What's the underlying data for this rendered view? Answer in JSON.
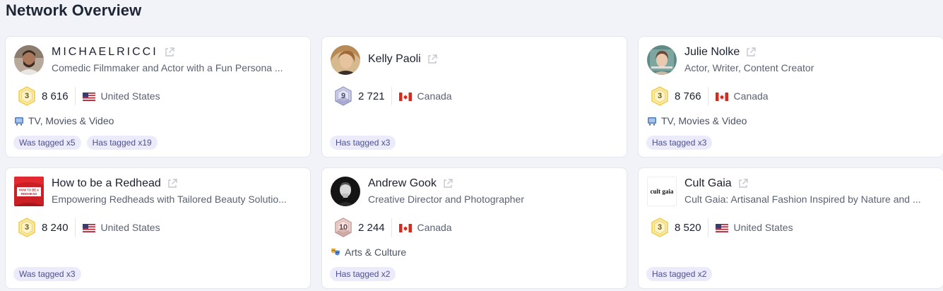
{
  "page_title": "Network Overview",
  "cards": [
    {
      "name": "MICHAELRICCI",
      "bio": "Comedic Filmmaker and Actor with a Fun Persona ...",
      "level": "3",
      "score": "8 616",
      "country": "United States",
      "category": "TV, Movies & Video",
      "tags": [
        "Was tagged x5",
        "Has tagged x19"
      ]
    },
    {
      "name": "Kelly Paoli",
      "bio": "",
      "level": "9",
      "score": "2 721",
      "country": "Canada",
      "category": "",
      "tags": [
        "Has tagged x3"
      ]
    },
    {
      "name": "Julie Nolke",
      "bio": "Actor, Writer, Content Creator",
      "level": "3",
      "score": "8 766",
      "country": "Canada",
      "category": "TV, Movies & Video",
      "tags": [
        "Has tagged x3"
      ]
    },
    {
      "name": "How to be a Redhead",
      "bio": "Empowering Redheads with Tailored Beauty Solutio...",
      "level": "3",
      "score": "8 240",
      "country": "United States",
      "category": "",
      "tags": [
        "Was tagged x3"
      ]
    },
    {
      "name": "Andrew Gook",
      "bio": "Creative Director and Photographer",
      "level": "10",
      "score": "2 244",
      "country": "Canada",
      "category": "Arts & Culture",
      "tags": [
        "Has tagged x2"
      ]
    },
    {
      "name": "Cult Gaia",
      "bio": "Cult Gaia: Artisanal Fashion Inspired by Nature and ...",
      "level": "3",
      "score": "8 520",
      "country": "United States",
      "category": "",
      "tags": [
        "Has tagged x2"
      ]
    }
  ],
  "avatars": {
    "redhead_logo_text": "HOW TO BE A REDHEAD",
    "cultgaia_logo_text": "cult gaia"
  }
}
